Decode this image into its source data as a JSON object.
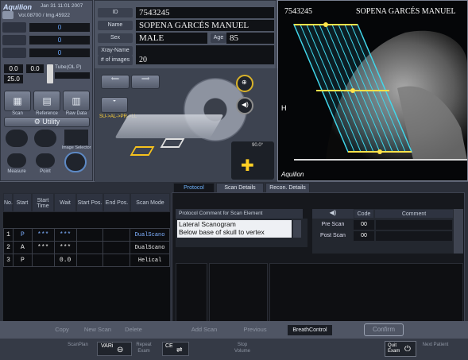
{
  "app": {
    "logo": "Aquilion",
    "datetime": "Jan 31 11:01 2007",
    "vol": "Vol.08700 / Img.45922"
  },
  "status": {
    "val1": "0",
    "val2": "0",
    "val3": "0",
    "ma": "0.0",
    "ma2": "0.0",
    "kv": "25.0",
    "tube_label": "Tube(OL P)",
    "tube_pct": "0"
  },
  "left_tools": {
    "scan": "Scan",
    "reference": "Reference",
    "raw_data": "Raw Data",
    "utility": "Utility",
    "image_selector": "Image Selector",
    "measure": "Measure",
    "point": "Point"
  },
  "patient": {
    "id_label": "ID",
    "id": "7543245",
    "name_label": "Name",
    "name": "SOPENA GARCÉS MANUEL",
    "sex_label": "Sex",
    "sex": "MALE",
    "age_label": "Age",
    "age": "85",
    "xray_label": "Xray-Name",
    "xray": "",
    "images_label": "# of images",
    "images": "20"
  },
  "gantry": {
    "mode_label": "SU->AL->PR->LL",
    "tilt": "90.0°"
  },
  "preview": {
    "id": "7543245",
    "name": "SOPENA GARCÉS MANUEL",
    "logo": "Aquilion",
    "side_label": "H"
  },
  "scan_table": {
    "headers": [
      "No.",
      "Start",
      "Start Time",
      "Wait",
      "Start Pos.",
      "End Pos.",
      "Scan Mode"
    ],
    "rows": [
      {
        "no": "1",
        "start": "P",
        "start_time": "***",
        "wait": "***",
        "start_pos": "",
        "end_pos": "",
        "mode": "DualScano"
      },
      {
        "no": "2",
        "start": "A",
        "start_time": "***",
        "wait": "***",
        "start_pos": "",
        "end_pos": "",
        "mode": "DualScano"
      },
      {
        "no": "3",
        "start": "P",
        "start_time": "",
        "wait": "0.0",
        "start_pos": "",
        "end_pos": "",
        "mode": "Helical"
      }
    ]
  },
  "tabs": {
    "protocol": "Protocol",
    "scan_details": "Scan Details",
    "recon_details": "Recon. Details"
  },
  "protocol": {
    "comment_header": "Protocol Comment for Scan Element",
    "comment_line1": "Lateral Scanogram",
    "comment_line2": "Below base of skull to vertex",
    "code_header": "Code",
    "comment_col": "Comment",
    "pre_scan": "Pre Scan",
    "pre_code": "00",
    "post_scan": "Post Scan",
    "post_code": "00"
  },
  "actions": {
    "copy": "Copy",
    "new_scan": "New Scan",
    "delete": "Delete",
    "add_scan": "Add Scan",
    "previous": "Previous",
    "breath_control": "BreathControl",
    "confirm": "Confirm"
  },
  "footer": {
    "scan_plan": "ScanPlan",
    "vari": "VARi",
    "repeat_exam": "Repeat Exam",
    "ce": "CE",
    "stop_volume": "Stop Volume",
    "quit_exam": "Quit Exam",
    "next_patient": "Next Patient"
  }
}
